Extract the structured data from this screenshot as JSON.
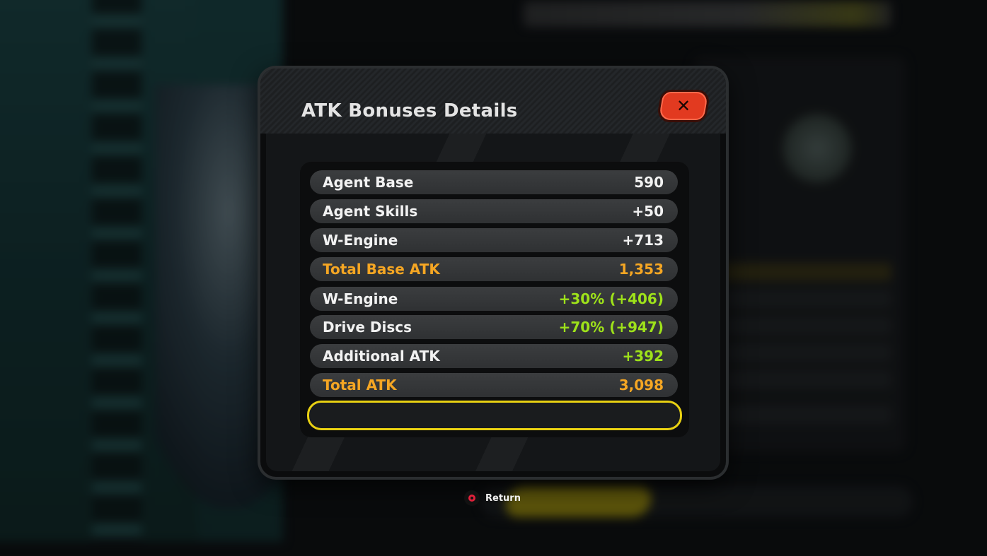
{
  "dialog": {
    "title": "ATK Bonuses Details",
    "close_icon": "close-icon"
  },
  "stats": [
    {
      "label": "Agent Base",
      "value": "590",
      "style": "normal"
    },
    {
      "label": "Agent Skills",
      "value": "+50",
      "style": "normal"
    },
    {
      "label": "W-Engine",
      "value": "+713",
      "style": "normal"
    },
    {
      "label": "Total Base ATK",
      "value": "1,353",
      "style": "total"
    },
    {
      "label": "W-Engine",
      "value": "+30% (+406)",
      "style": "bonus"
    },
    {
      "label": "Drive Discs",
      "value": "+70% (+947)",
      "style": "bonus"
    },
    {
      "label": "Additional ATK",
      "value": "+392",
      "style": "bonus"
    },
    {
      "label": "Total ATK",
      "value": "3,098",
      "style": "total"
    }
  ],
  "footer": {
    "return_label": "Return",
    "return_icon": "circle-button-icon"
  },
  "colors": {
    "total": "#f5a623",
    "bonus": "#9ee21a",
    "highlight": "#e8d012",
    "close_button": "#e23a20"
  }
}
